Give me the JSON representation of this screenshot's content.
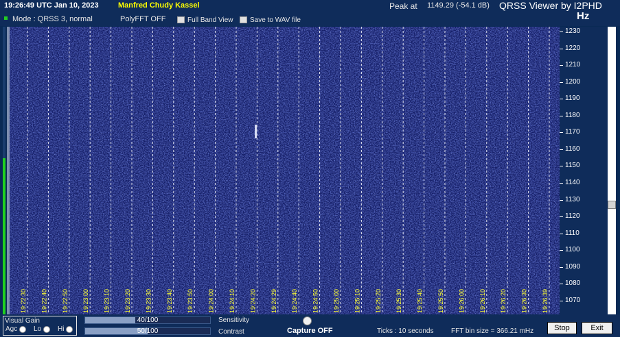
{
  "header": {
    "utc": "19:26:49 UTC  Jan 10, 2023",
    "operator": "Manfred Chudy Kassel",
    "peak_label": "Peak at",
    "peak_value": "1149.29 (-54.1 dB)",
    "app_title": "QRSS Viewer by I2PHD",
    "unit": "Hz",
    "mode": "Mode : QRSS 3, normal",
    "polyfft": "PolyFFT OFF",
    "full_band_label": "Full Band View",
    "save_wav_label": "Save to WAV file"
  },
  "waterfall": {
    "time_labels": [
      "19:22:30",
      "19:22:40",
      "19:22:50",
      "19:23:00",
      "19:23:10",
      "19:23:20",
      "19:23:30",
      "19:23:40",
      "19:23:50",
      "19:24:00",
      "19:24:10",
      "19:24:20",
      "19:24:29",
      "19:24:40",
      "19:24:50",
      "19:25:00",
      "19:25:10",
      "19:25:20",
      "19:25:30",
      "19:25:40",
      "19:25:50",
      "19:26:00",
      "19:26:10",
      "19:26:20",
      "19:26:30",
      "19:26:39"
    ],
    "hz_labels": [
      "1230",
      "1220",
      "1210",
      "1200",
      "1190",
      "1180",
      "1170",
      "1160",
      "1150",
      "1140",
      "1130",
      "1120",
      "1110",
      "1100",
      "1090",
      "1080",
      "1070"
    ]
  },
  "bottom": {
    "visual_gain_title": "Visual Gain",
    "agc_label": "Agc",
    "lo_label": "Lo",
    "hi_label": "Hi",
    "sensitivity_value": "40/100",
    "sensitivity_fraction": 0.4,
    "sensitivity_label": "Sensitivity",
    "contrast_value": "50/100",
    "contrast_fraction": 0.5,
    "contrast_label": "Contrast",
    "capture_label": "Capture OFF",
    "ticks_label": "Ticks   : 10 seconds",
    "fft_bin_label": "FFT bin size = 366.21 mHz",
    "stop_label": "Stop",
    "exit_label": "Exit"
  },
  "colors": {
    "waterfall_bg": "#141d66",
    "operator_text": "#ffff00",
    "status_led": "#22cc22"
  }
}
